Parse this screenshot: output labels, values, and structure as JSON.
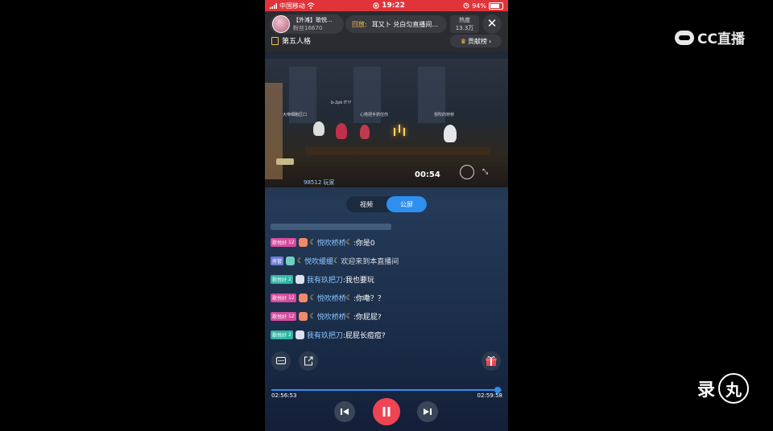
{
  "watermarks": {
    "cc": "CC直播",
    "recorder": "录",
    "recorder_circle": "丸"
  },
  "status_bar": {
    "carrier": "中国移动",
    "time": "19:22",
    "battery": "94%",
    "battery_level": 0.94
  },
  "header": {
    "anchor_name": "【外滩】歌悦...",
    "fans": "粉丝16670",
    "replay_label": "回放:",
    "replay_title": "耳又卜 兑白匀直播间...",
    "heat_label": "热度",
    "heat_value": "13.3万",
    "game_tag": "第五人格",
    "rank_label": "贡献榜",
    "rank_arrow": "›",
    "close_glyph": "✕"
  },
  "video": {
    "timer": "00:54",
    "viewers": "98512 玩家",
    "labels": [
      "b-2pk IT!?",
      "大帝细胞区口",
      "心搭把手抓住你",
      "悦吹的桥桥"
    ]
  },
  "tabs": [
    {
      "label": "视频",
      "active": false
    },
    {
      "label": "公屏",
      "active": true
    }
  ],
  "chat": [
    {
      "badge": "",
      "badge_color": "#6c7bd8",
      "level": "",
      "user": "",
      "text": "",
      "faded": true
    },
    {
      "badge": "歌悦好",
      "level": "12",
      "badge_color": "#d54a9c",
      "icon_color": "#f08a6a",
      "moon": true,
      "user": "悦吹桥桥",
      "text": ":你是0"
    },
    {
      "badge": "房管",
      "level": "",
      "badge_color": "#6c7bd8",
      "icon_color": "#6fd0c0",
      "moon": true,
      "user": "悦吹缓缓",
      "text": "欢迎来到本直播间",
      "system": true
    },
    {
      "badge": "歌悦好",
      "level": "2",
      "badge_color": "#2fb6a2",
      "icon_color": "#d9e2ee",
      "moon": false,
      "user": "我有玖把刀",
      "text": ":我也要玩"
    },
    {
      "badge": "歌悦好",
      "level": "12",
      "badge_color": "#d54a9c",
      "icon_color": "#f08a6a",
      "moon": true,
      "user": "悦吹桥桥",
      "text": ":你嘞？？"
    },
    {
      "badge": "歌悦好",
      "level": "12",
      "badge_color": "#d54a9c",
      "icon_color": "#f08a6a",
      "moon": true,
      "user": "悦吹桥桥",
      "text": ":你屁屁?"
    },
    {
      "badge": "歌悦好",
      "level": "2",
      "badge_color": "#2fb6a2",
      "icon_color": "#d9e2ee",
      "moon": false,
      "user": "我有玖把刀",
      "text": ":屁屁长痘痘?"
    }
  ],
  "player": {
    "elapsed": "02:56:53",
    "total": "02:59:58",
    "progress": 0.984,
    "accent": "#2f8ff0",
    "play_color": "#ef4454"
  }
}
